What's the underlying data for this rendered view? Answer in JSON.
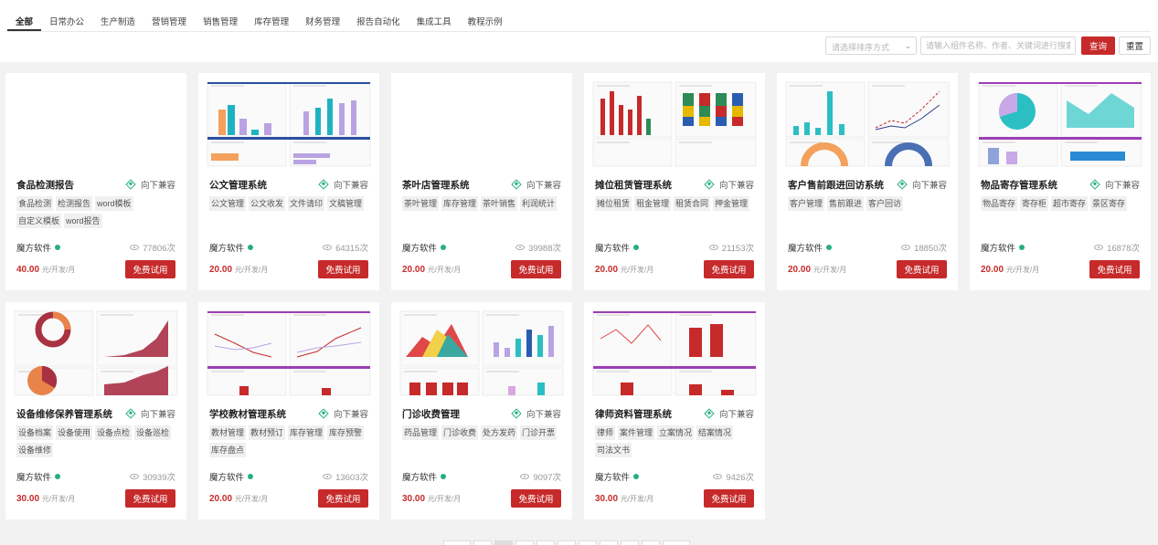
{
  "tabs": [
    "全部",
    "日常办公",
    "生产制造",
    "营销管理",
    "销售管理",
    "库存管理",
    "财务管理",
    "报告自动化",
    "集成工具",
    "教程示例"
  ],
  "filters": {
    "sort_placeholder": "请选择排序方式",
    "search_placeholder": "请输入组件名称、作者、关键词进行搜索",
    "query_label": "查询",
    "reset_label": "重置"
  },
  "card_common": {
    "compat_label": "向下兼容",
    "try_label": "免费试用",
    "price_unit": "元/开发/月"
  },
  "products": [
    {
      "title": "食品检测报告",
      "tags": [
        "食品检测",
        "检测报告",
        "word模板",
        "自定义模板",
        "word报告"
      ],
      "author": "魔方软件",
      "views": "77806次",
      "price": "40.00",
      "thumb": "blank"
    },
    {
      "title": "公文管理系统",
      "tags": [
        "公文管理",
        "公文收发",
        "文件请印",
        "文稿管理"
      ],
      "author": "魔方软件",
      "views": "64315次",
      "price": "20.00",
      "thumb": "office"
    },
    {
      "title": "茶叶店管理系统",
      "tags": [
        "茶叶管理",
        "库存管理",
        "茶叶销售",
        "利润统计"
      ],
      "author": "魔方软件",
      "views": "39988次",
      "price": "20.00",
      "thumb": "blank"
    },
    {
      "title": "摊位租赁管理系统",
      "tags": [
        "摊位租赁",
        "租金管理",
        "租赁合同",
        "押金管理"
      ],
      "author": "魔方软件",
      "views": "21153次",
      "price": "20.00",
      "thumb": "stall"
    },
    {
      "title": "客户售前跟进回访系统",
      "tags": [
        "客户管理",
        "售前跟进",
        "客户回访"
      ],
      "author": "魔方软件",
      "views": "18850次",
      "price": "20.00",
      "thumb": "customer"
    },
    {
      "title": "物品寄存管理系统",
      "tags": [
        "物品寄存",
        "寄存柜",
        "超市寄存",
        "景区寄存"
      ],
      "author": "魔方软件",
      "views": "16878次",
      "price": "20.00",
      "thumb": "storage"
    },
    {
      "title": "设备维修保养管理系统",
      "tags": [
        "设备档案",
        "设备使用",
        "设备点检",
        "设备巡检",
        "设备维修"
      ],
      "author": "魔方软件",
      "views": "30939次",
      "price": "30.00",
      "thumb": "equipment"
    },
    {
      "title": "学校教材管理系统",
      "tags": [
        "教材管理",
        "教材预订",
        "库存管理",
        "库存预警",
        "库存盘点"
      ],
      "author": "魔方软件",
      "views": "13603次",
      "price": "20.00",
      "thumb": "school"
    },
    {
      "title": "门诊收费管理",
      "tags": [
        "药品管理",
        "门诊收费",
        "处方发药",
        "门诊开票"
      ],
      "author": "魔方软件",
      "views": "9097次",
      "price": "30.00",
      "thumb": "clinic"
    },
    {
      "title": "律师资料管理系统",
      "tags": [
        "律师",
        "案件管理",
        "立案情况",
        "结案情况",
        "司法文书"
      ],
      "author": "魔方软件",
      "views": "9426次",
      "price": "30.00",
      "thumb": "lawyer"
    }
  ]
}
